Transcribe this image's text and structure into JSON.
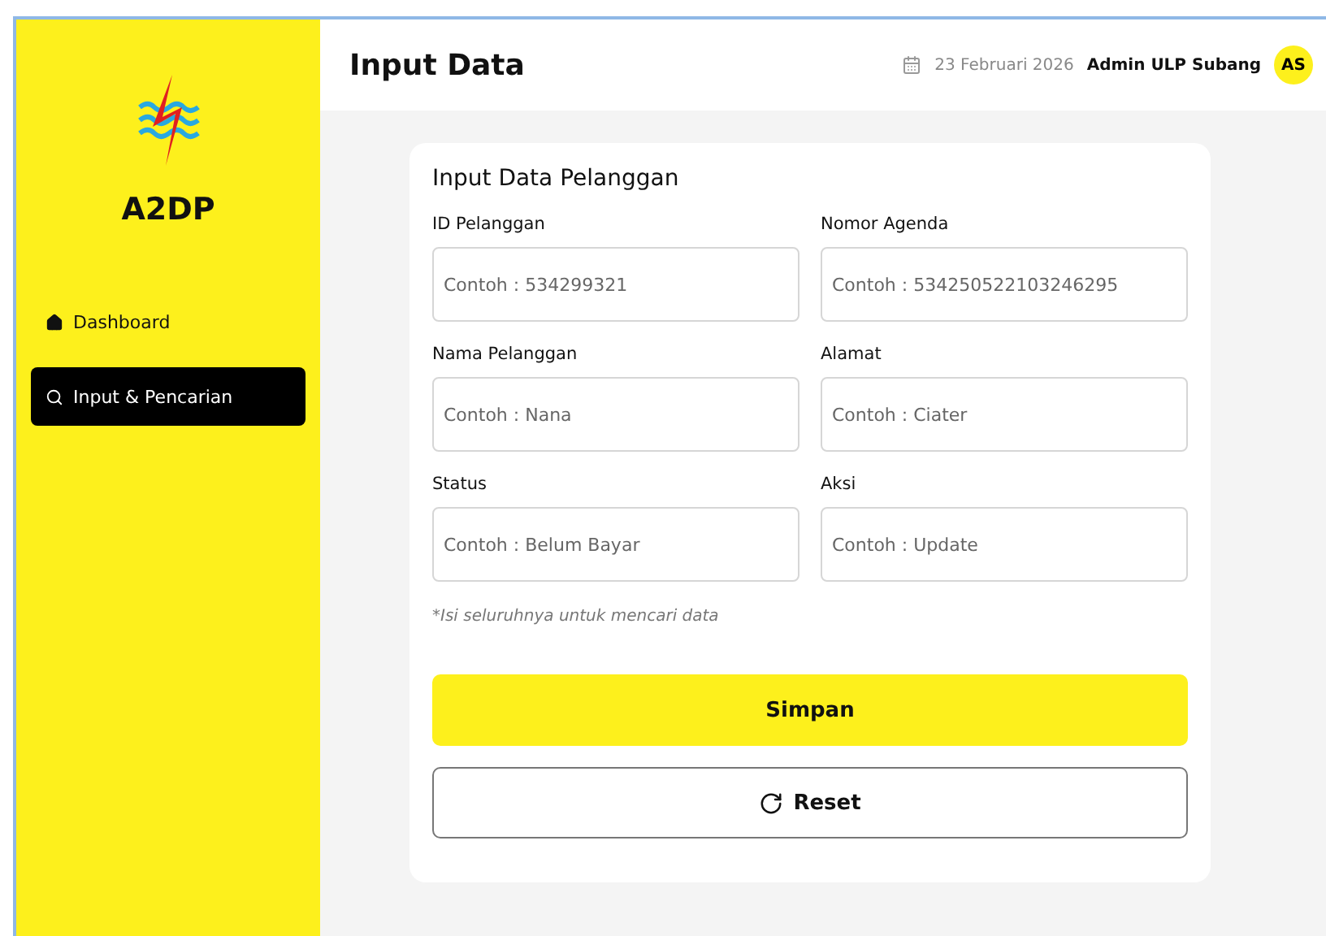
{
  "sidebar": {
    "brand": "A2DP",
    "items": [
      {
        "label": "Dashboard",
        "selected": false
      },
      {
        "label": "Input & Pencarian",
        "selected": true
      }
    ]
  },
  "header": {
    "title": "Input Data",
    "date": "23 Februari 2026",
    "user": "Admin ULP Subang",
    "avatar": "AS"
  },
  "form": {
    "title": "Input Data Pelanggan",
    "fields": [
      {
        "label": "ID Pelanggan",
        "placeholder": "Contoh : 534299321"
      },
      {
        "label": "Nomor Agenda",
        "placeholder": "Contoh : 534250522103246295"
      },
      {
        "label": "Nama Pelanggan",
        "placeholder": "Contoh : Nana"
      },
      {
        "label": "Alamat",
        "placeholder": "Contoh : Ciater"
      },
      {
        "label": "Status",
        "placeholder": "Contoh : Belum Bayar"
      },
      {
        "label": "Aksi",
        "placeholder": "Contoh : Update"
      }
    ],
    "note": "*Isi seluruhnya untuk mencari data",
    "submit": "Simpan",
    "reset": "Reset"
  }
}
